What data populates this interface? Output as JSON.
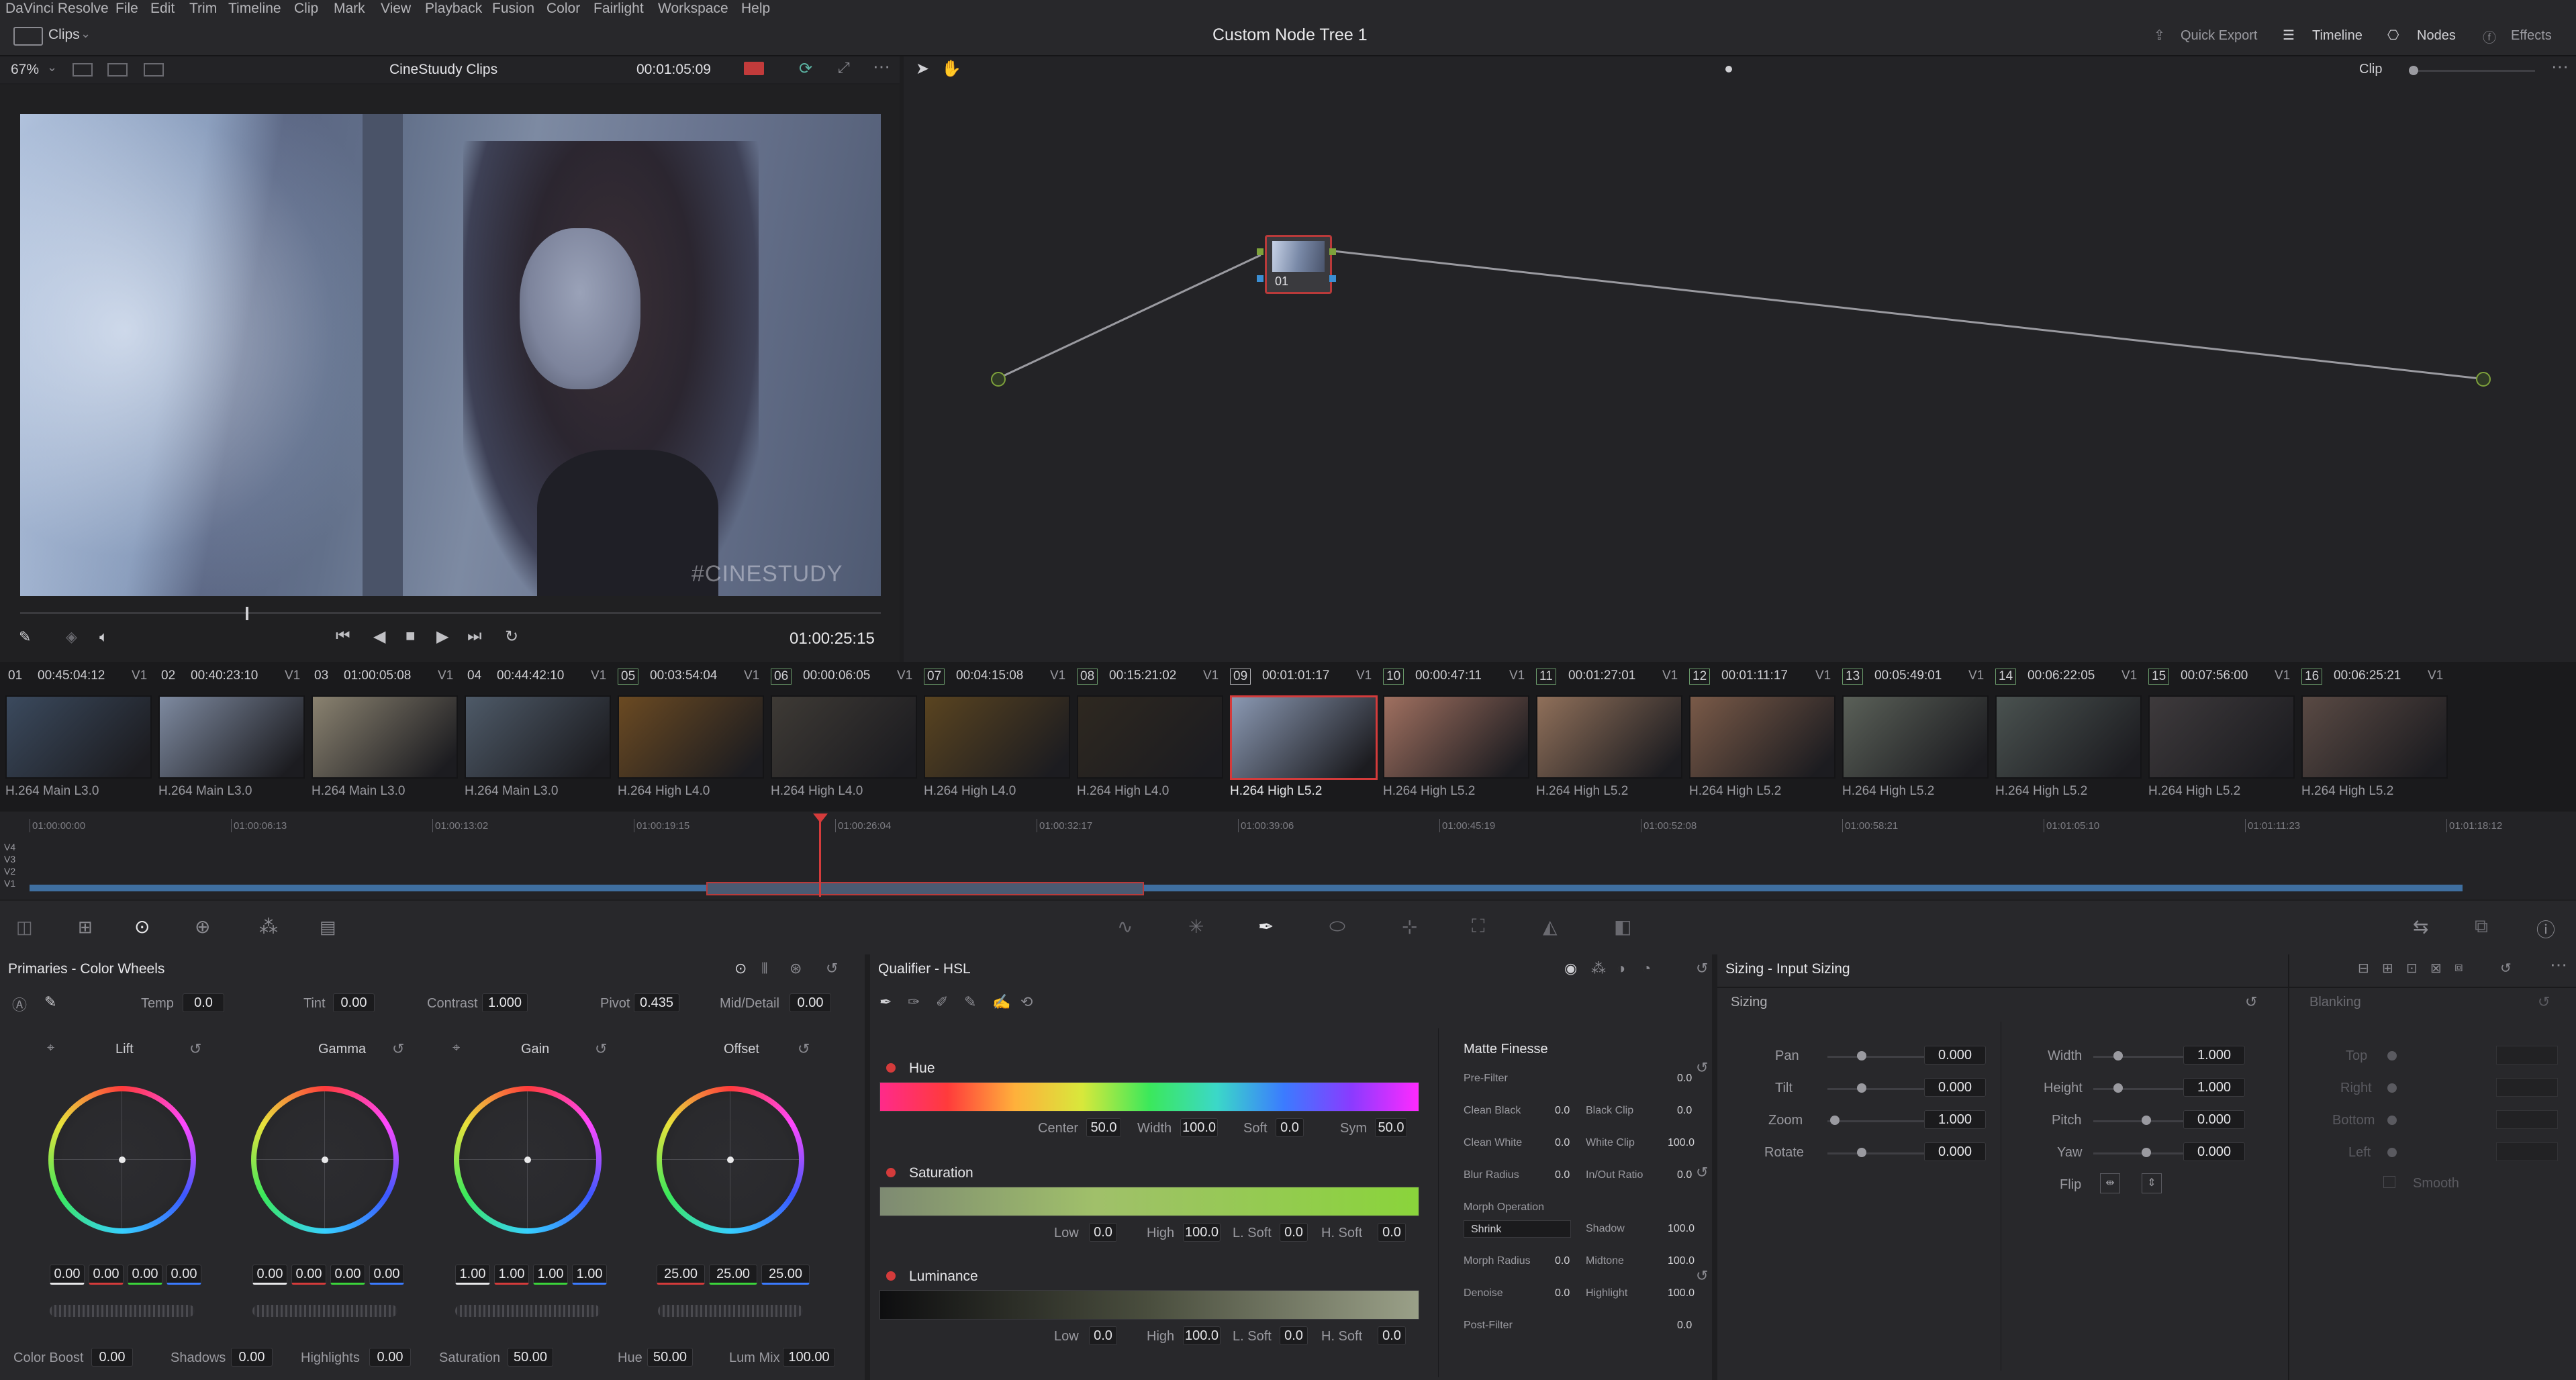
{
  "menu": {
    "app": "DaVinci Resolve",
    "items": [
      "File",
      "Edit",
      "Trim",
      "Timeline",
      "Clip",
      "Mark",
      "View",
      "Playback",
      "Fusion",
      "Color",
      "Fairlight",
      "Workspace",
      "Help"
    ]
  },
  "topbar": {
    "clips_label": "Clips",
    "title": "Custom Node Tree 1",
    "quick_export": "Quick Export",
    "timeline": "Timeline",
    "nodes": "Nodes",
    "effects": "Effects"
  },
  "viewer": {
    "zoom": "67%",
    "clip_bin": "CineStuudy Clips",
    "timecode": "00:01:05:09",
    "playhead_tc": "01:00:25:15",
    "watermark": "#CINESTUDY",
    "mode": "Clip"
  },
  "nodes": {
    "node_label": "01"
  },
  "clips": [
    {
      "num": "01",
      "tc": "00:45:04:12",
      "track": "V1",
      "codec": "H.264 Main L3.0",
      "color": "#3b4a5e"
    },
    {
      "num": "02",
      "tc": "00:40:23:10",
      "track": "V1",
      "codec": "H.264 Main L3.0",
      "color": "#7e8aa0"
    },
    {
      "num": "03",
      "tc": "01:00:05:08",
      "track": "V1",
      "codec": "H.264 Main L3.0",
      "color": "#8a8270"
    },
    {
      "num": "04",
      "tc": "00:44:42:10",
      "track": "V1",
      "codec": "H.264 Main L3.0",
      "color": "#4e5a68"
    },
    {
      "num": "05",
      "tc": "00:03:54:04",
      "track": "V1",
      "codec": "H.264 High L4.0",
      "color": "#6b4a22"
    },
    {
      "num": "06",
      "tc": "00:00:06:05",
      "track": "V1",
      "codec": "H.264 High L4.0",
      "color": "#3e3a35"
    },
    {
      "num": "07",
      "tc": "00:04:15:08",
      "track": "V1",
      "codec": "H.264 High L4.0",
      "color": "#5a4420"
    },
    {
      "num": "08",
      "tc": "00:15:21:02",
      "track": "V1",
      "codec": "H.264 High L4.0",
      "color": "#2e2820"
    },
    {
      "num": "09",
      "tc": "00:01:01:17",
      "track": "V1",
      "codec": "H.264 High L5.2",
      "color": "#8a98b2"
    },
    {
      "num": "10",
      "tc": "00:00:47:11",
      "track": "V1",
      "codec": "H.264 High L5.2",
      "color": "#a07060"
    },
    {
      "num": "11",
      "tc": "00:01:27:01",
      "track": "V1",
      "codec": "H.264 High L5.2",
      "color": "#90705a"
    },
    {
      "num": "12",
      "tc": "00:01:11:17",
      "track": "V1",
      "codec": "H.264 High L5.2",
      "color": "#7a5a48"
    },
    {
      "num": "13",
      "tc": "00:05:49:01",
      "track": "V1",
      "codec": "H.264 High L5.2",
      "color": "#5a6058"
    },
    {
      "num": "14",
      "tc": "00:06:22:05",
      "track": "V1",
      "codec": "H.264 High L5.2",
      "color": "#4a5250"
    },
    {
      "num": "15",
      "tc": "00:07:56:00",
      "track": "V1",
      "codec": "H.264 High L5.2",
      "color": "#3e3a3c"
    },
    {
      "num": "16",
      "tc": "00:06:25:21",
      "track": "V1",
      "codec": "H.264 High L5.2",
      "color": "#5a4a44"
    }
  ],
  "timeline": {
    "ticks": [
      "01:00:00:00",
      "01:00:06:13",
      "01:00:13:02",
      "01:00:19:15",
      "01:00:26:04",
      "01:00:32:17",
      "01:00:39:06",
      "01:00:45:19",
      "01:00:52:08",
      "01:00:58:21",
      "01:01:05:10",
      "01:01:11:23",
      "01:01:18:12"
    ],
    "tracks": [
      "V4",
      "V3",
      "V2",
      "V1"
    ]
  },
  "primaries": {
    "title": "Primaries - Color Wheels",
    "temp_label": "Temp",
    "temp": "0.0",
    "tint_label": "Tint",
    "tint": "0.00",
    "contrast_label": "Contrast",
    "contrast": "1.000",
    "pivot_label": "Pivot",
    "pivot": "0.435",
    "middetail_label": "Mid/Detail",
    "middetail": "0.00",
    "wheels": [
      {
        "name": "Lift",
        "values": [
          "0.00",
          "0.00",
          "0.00",
          "0.00"
        ]
      },
      {
        "name": "Gamma",
        "values": [
          "0.00",
          "0.00",
          "0.00",
          "0.00"
        ]
      },
      {
        "name": "Gain",
        "values": [
          "1.00",
          "1.00",
          "1.00",
          "1.00"
        ]
      },
      {
        "name": "Offset",
        "values": [
          "25.00",
          "25.00",
          "25.00"
        ]
      }
    ],
    "colorboost_label": "Color Boost",
    "colorboost": "0.00",
    "shadows_label": "Shadows",
    "shadows": "0.00",
    "highlights_label": "Highlights",
    "highlights": "0.00",
    "saturation_label": "Saturation",
    "saturation": "50.00",
    "hue_label": "Hue",
    "hue": "50.00",
    "lummix_label": "Lum Mix",
    "lummix": "100.00"
  },
  "qualifier": {
    "title": "Qualifier - HSL",
    "hue": {
      "label": "Hue",
      "center_label": "Center",
      "center": "50.0",
      "width_label": "Width",
      "width": "100.0",
      "soft_label": "Soft",
      "soft": "0.0",
      "sym_label": "Sym",
      "sym": "50.0"
    },
    "saturation": {
      "label": "Saturation",
      "low_label": "Low",
      "low": "0.0",
      "high_label": "High",
      "high": "100.0",
      "lsoft_label": "L. Soft",
      "lsoft": "0.0",
      "hsoft_label": "H. Soft",
      "hsoft": "0.0"
    },
    "luminance": {
      "label": "Luminance",
      "low_label": "Low",
      "low": "0.0",
      "high_label": "High",
      "high": "100.0",
      "lsoft_label": "L. Soft",
      "lsoft": "0.0",
      "hsoft_label": "H. Soft",
      "hsoft": "0.0"
    },
    "matte": {
      "title": "Matte Finesse",
      "prefilter_label": "Pre-Filter",
      "prefilter": "0.0",
      "cleanblack_label": "Clean Black",
      "cleanblack": "0.0",
      "blackclip_label": "Black Clip",
      "blackclip": "0.0",
      "cleanwhite_label": "Clean White",
      "cleanwhite": "0.0",
      "whiteclip_label": "White Clip",
      "whiteclip": "100.0",
      "blurradius_label": "Blur Radius",
      "blurradius": "0.0",
      "inoutratio_label": "In/Out Ratio",
      "inoutratio": "0.0",
      "morphop_label": "Morph Operation",
      "morphop": "Shrink",
      "shadow_label": "Shadow",
      "shadow": "100.0",
      "morphradius_label": "Morph Radius",
      "morphradius": "0.0",
      "midtone_label": "Midtone",
      "midtone": "100.0",
      "denoise_label": "Denoise",
      "denoise": "0.0",
      "highlight_label": "Highlight",
      "highlight": "100.0",
      "postfilter_label": "Post-Filter",
      "postfilter": "0.0"
    }
  },
  "sizing": {
    "title": "Sizing - Input Sizing",
    "section": "Sizing",
    "blanking": "Blanking",
    "pan_label": "Pan",
    "pan": "0.000",
    "tilt_label": "Tilt",
    "tilt": "0.000",
    "zoom_label": "Zoom",
    "zoom": "1.000",
    "rotate_label": "Rotate",
    "rotate": "0.000",
    "width_label": "Width",
    "width": "1.000",
    "height_label": "Height",
    "height": "1.000",
    "pitch_label": "Pitch",
    "pitch": "0.000",
    "yaw_label": "Yaw",
    "yaw": "0.000",
    "flip_label": "Flip",
    "top_label": "Top",
    "right_label": "Right",
    "bottom_label": "Bottom",
    "left_label": "Left",
    "smooth_label": "Smooth"
  }
}
